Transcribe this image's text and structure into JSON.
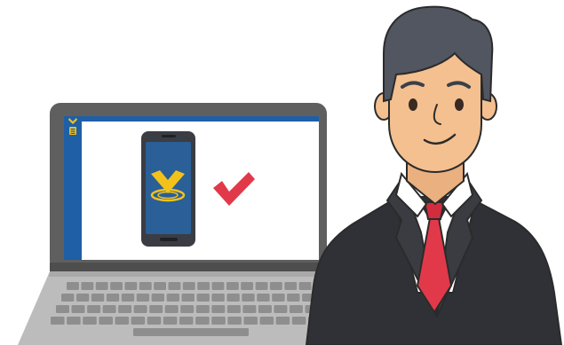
{
  "scene": {
    "description_icons": [
      "laptop",
      "smartphone",
      "app-logo",
      "checkmark",
      "businessman"
    ]
  },
  "colors": {
    "background": "#ffffff",
    "laptop_frame": "#5f5f5f",
    "laptop_frame_dark": "#4e4e4e",
    "screen_bg": "#ffffff",
    "sidebar_blue": "#1e5fa6",
    "logo_yellow": "#f2c21b",
    "phone_body": "#3a3d44",
    "phone_screen": "#2a5f98",
    "check_red": "#e2394a",
    "keyboard_base": "#bcbcbc",
    "key_color": "#8e8e8e",
    "suit": "#2f3136",
    "suit_shadow": "#24262a",
    "shirt": "#ffffff",
    "tie": "#e2394a",
    "skin": "#f4c08f",
    "hair": "#515661",
    "outline": "#2b2b2b"
  }
}
